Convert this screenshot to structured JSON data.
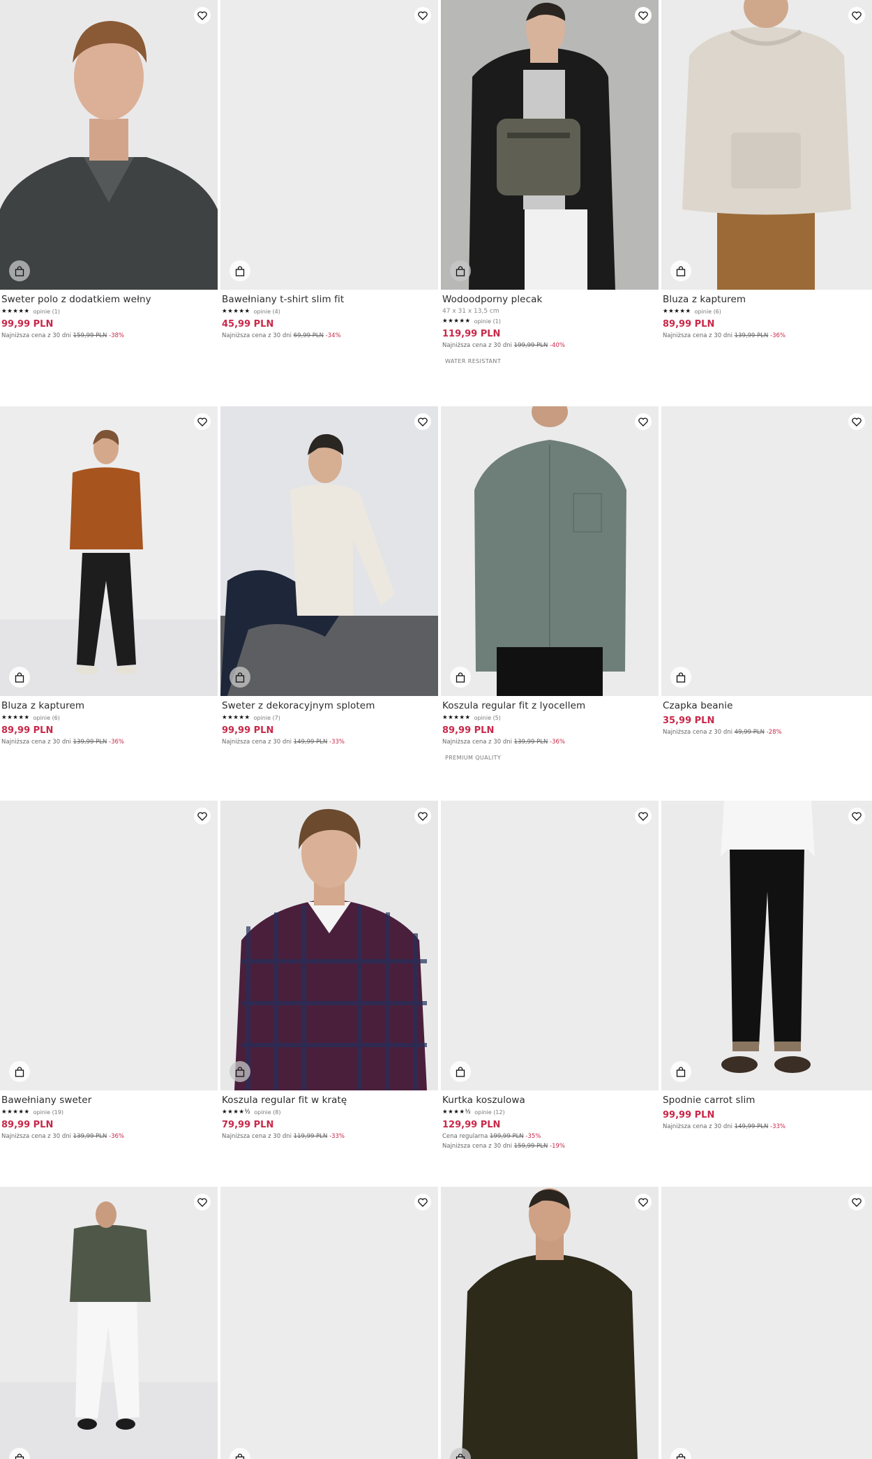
{
  "labels": {
    "price_history_prefix": "Najniższa cena z 30 dni",
    "regular_price_prefix": "Cena regularna"
  },
  "colors": {
    "price": "#c92849",
    "photo_bg": "#ececed",
    "text": "#2b2b2b"
  },
  "icons": {
    "favorite": "heart-icon",
    "add_to_cart": "shopping-bag-icon"
  },
  "products": [
    {
      "name": "Sweter polo z dodatkiem wełny",
      "stars": "★★★★★",
      "reviews": "opinie (1)",
      "price": "99,99 PLN",
      "old_price": "159,99 PLN",
      "discount": "-38%"
    },
    {
      "name": "Bawełniany t-shirt slim fit",
      "stars": "★★★★★",
      "reviews": "opinie (4)",
      "price": "45,99 PLN",
      "old_price": "69,99 PLN",
      "discount": "-34%"
    },
    {
      "name": "Wodoodporny plecak",
      "dims": "47 x 31 x 13,5 cm",
      "stars": "★★★★★",
      "reviews": "opinie (1)",
      "price": "119,99 PLN",
      "old_price": "199,99 PLN",
      "discount": "-40%",
      "tag": "WATER RESISTANT"
    },
    {
      "name": "Bluza z kapturem",
      "stars": "★★★★★",
      "reviews": "opinie (6)",
      "price": "89,99 PLN",
      "old_price": "139,99 PLN",
      "discount": "-36%"
    },
    {
      "name": "Bluza z kapturem",
      "stars": "★★★★★",
      "reviews": "opinie (6)",
      "price": "89,99 PLN",
      "old_price": "139,99 PLN",
      "discount": "-36%"
    },
    {
      "name": "Sweter z dekoracyjnym splotem",
      "stars": "★★★★★",
      "reviews": "opinie (7)",
      "price": "99,99 PLN",
      "old_price": "149,99 PLN",
      "discount": "-33%"
    },
    {
      "name": "Koszula regular fit z lyocellem",
      "stars": "★★★★★",
      "reviews": "opinie (5)",
      "price": "89,99 PLN",
      "old_price": "139,99 PLN",
      "discount": "-36%",
      "tag": "PREMIUM QUALITY"
    },
    {
      "name": "Czapka beanie",
      "price": "35,99 PLN",
      "old_price": "49,99 PLN",
      "discount": "-28%"
    },
    {
      "name": "Bawełniany sweter",
      "stars": "★★★★★",
      "reviews": "opinie (19)",
      "price": "89,99 PLN",
      "old_price": "139,99 PLN",
      "discount": "-36%"
    },
    {
      "name": "Koszula regular fit w kratę",
      "stars": "★★★★½",
      "reviews": "opinie (8)",
      "price": "79,99 PLN",
      "old_price": "119,99 PLN",
      "discount": "-33%"
    },
    {
      "name": "Kurtka koszulowa",
      "stars": "★★★★½",
      "reviews": "opinie (12)",
      "price": "129,99 PLN",
      "regular_price": "199,99 PLN",
      "regular_discount": "-35%",
      "old_price": "159,99 PLN",
      "discount": "-19%"
    },
    {
      "name": "Spodnie carrot slim",
      "price": "99,99 PLN",
      "old_price": "149,99 PLN",
      "discount": "-33%"
    },
    {},
    {},
    {},
    {}
  ]
}
